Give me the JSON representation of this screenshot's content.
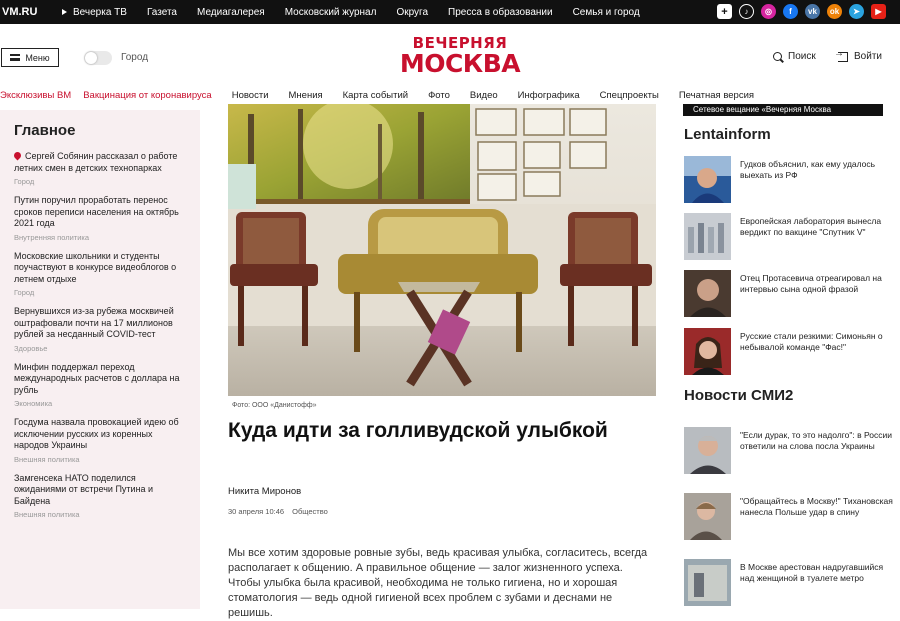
{
  "topbar": {
    "logo": "VM.RU",
    "nav": [
      "Вечерка ТВ",
      "Газета",
      "Медиагалерея",
      "Московский журнал",
      "Округа",
      "Пресса в образовании",
      "Семья и город"
    ],
    "socials": [
      "plus-icon",
      "tiktok-icon",
      "instagram-icon",
      "facebook-icon",
      "vk-icon",
      "ok-icon",
      "telegram-icon",
      "youtube-icon"
    ]
  },
  "header": {
    "menu_label": "Меню",
    "city_label": "Город",
    "brand_line1": "ВЕЧЕРНЯЯ",
    "brand_line2": "МОСКВА",
    "search_label": "Поиск",
    "login_label": "Войти"
  },
  "secnav": [
    "Эксклюзивы ВМ",
    "Вакцинация от коронавируса",
    "Новости",
    "Мнения",
    "Карта событий",
    "Фото",
    "Видео",
    "Инфографика",
    "Спецпроекты",
    "Печатная версия"
  ],
  "left": {
    "title": "Главное",
    "items": [
      {
        "text": "Сергей Собянин рассказал о работе летних смен в детских технопарках",
        "category": "Город"
      },
      {
        "text": "Путин поручил проработать перенос сроков переписи населения на октябрь 2021 года",
        "category": "Внутренняя политика"
      },
      {
        "text": "Московские школьники и студенты поучаствуют в конкурсе видеоблогов о летнем отдыхе",
        "category": "Город"
      },
      {
        "text": "Вернувшихся из-за рубежа москвичей оштрафовали почти на 17 миллионов рублей за несданный COVID-тест",
        "category": "Здоровье"
      },
      {
        "text": "Минфин поддержал переход международных расчетов с доллара на рубль",
        "category": "Экономика"
      },
      {
        "text": "Госдума назвала провокацией идею об исключении русских из коренных народов Украины",
        "category": "Внешняя политика"
      },
      {
        "text": "Замгенсека НАТО поделился ожиданиями от встречи Путина и Байдена",
        "category": "Внешняя политика"
      }
    ]
  },
  "article": {
    "caption": "Фото: ООО «Данистофф»",
    "title": "Куда идти за голливудской улыбкой",
    "author": "Никита Миронов",
    "date": "30 апреля 10:46",
    "rubric": "Общество",
    "body": "Мы все хотим здоровые ровные зубы, ведь красивая улыбка, согласитесь, всегда располагает к общению. А правильное общение — залог жизненного успеха. Чтобы улыбка была красивой, необходима не только гигиена, но и хорошая стоматология — ведь одной гигиеной всех проблем с зубами и деснами не решишь."
  },
  "right": {
    "strip": "Сетевое вещание «Вечерняя Москва",
    "lentainform_title": "Lentainform",
    "lentainform": [
      "Гудков объяснил, как ему удалось выехать из РФ",
      "Европейская лаборатория вынесла вердикт по вакцине \"Спутник V\"",
      "Отец Протасевича отреагировал на интервью сына одной фразой",
      "Русские стали резкими: Симоньян о небывалой команде \"Фас!\""
    ],
    "smi2_title": "Новости СМИ2",
    "smi2": [
      "\"Если дурак, то это надолго\": в России ответили на слова посла Украины",
      "\"Обращайтесь в Москву!\" Тихановская нанесла Польше удар в спину",
      "В Москве арестован надругавшийся над женщиной в туалете метро"
    ]
  },
  "colors": {
    "brand": "#c8102e",
    "sidebar_bg": "#f8eff1",
    "topbar_bg": "#111111"
  }
}
